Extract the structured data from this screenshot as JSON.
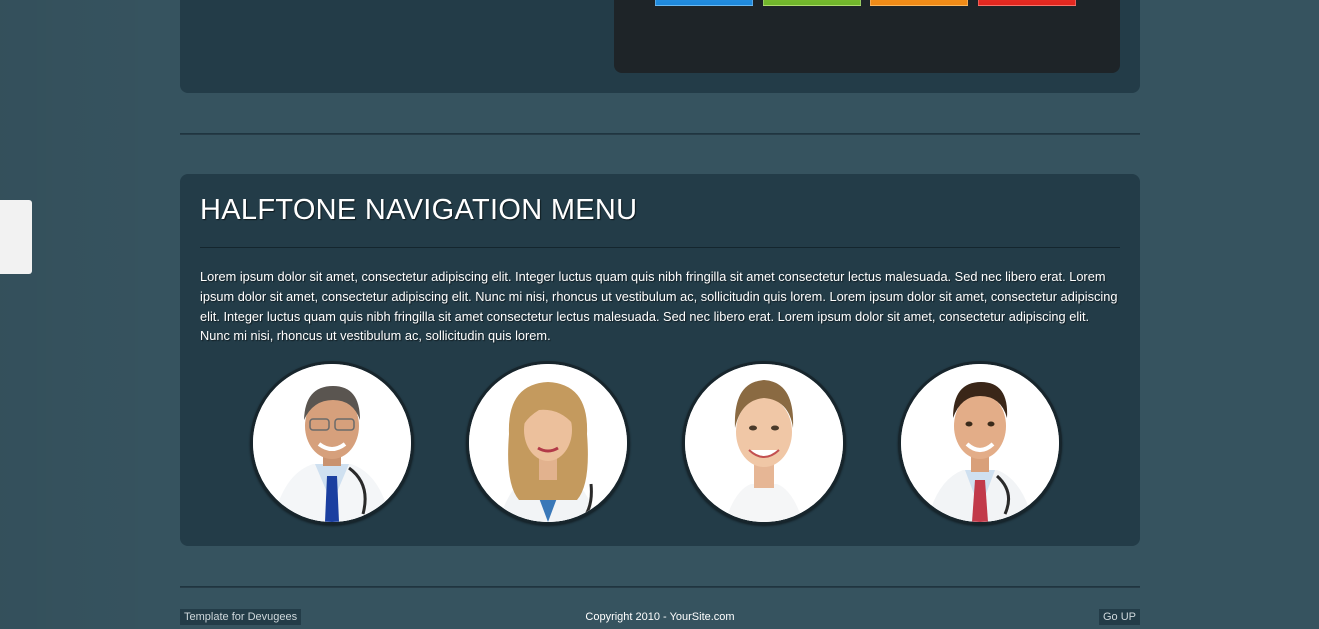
{
  "palette": {
    "swatches": [
      {
        "name": "blue",
        "color": "#2196ea"
      },
      {
        "name": "green",
        "color": "#82c433"
      },
      {
        "name": "orange",
        "color": "#f7951f"
      },
      {
        "name": "red",
        "color": "#ee3228"
      }
    ]
  },
  "section": {
    "title": "HALFTONE NAVIGATION MENU",
    "body": "Lorem ipsum dolor sit amet, consectetur adipiscing elit. Integer luctus quam quis nibh fringilla sit amet consectetur lectus malesuada. Sed nec libero erat. Lorem ipsum dolor sit amet, consectetur adipiscing elit. Nunc mi nisi, rhoncus ut vestibulum ac, sollicitudin quis lorem. Lorem ipsum dolor sit amet, consectetur adipiscing elit. Integer luctus quam quis nibh fringilla sit amet consectetur lectus malesuada. Sed nec libero erat. Lorem ipsum dolor sit amet, consectetur adipiscing elit. Nunc mi nisi, rhoncus ut vestibulum ac, sollicitudin quis lorem."
  },
  "footer": {
    "left": "Template for Devugees",
    "center": "Copyright 2010 - YourSite.com",
    "right": "Go UP"
  }
}
